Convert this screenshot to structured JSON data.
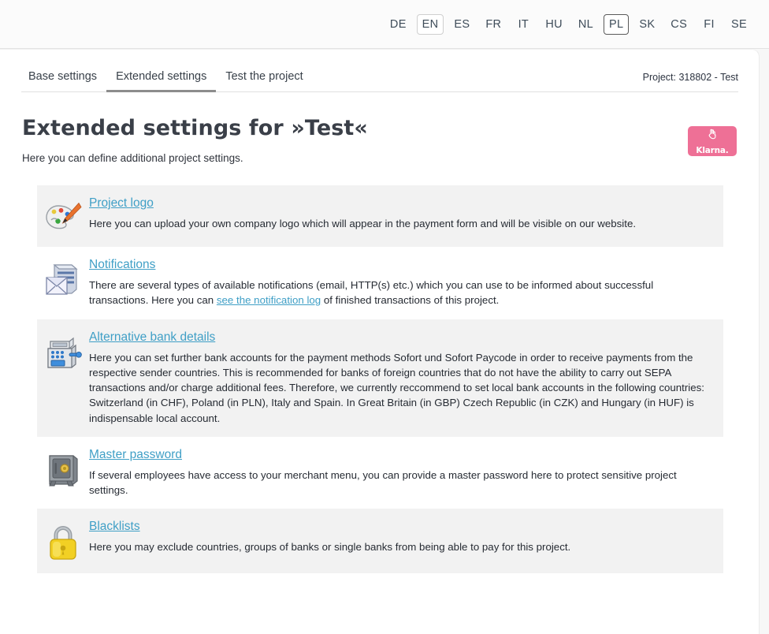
{
  "topbar": {
    "languages": [
      {
        "code": "DE",
        "state": "normal"
      },
      {
        "code": "EN",
        "state": "selected-light"
      },
      {
        "code": "ES",
        "state": "normal"
      },
      {
        "code": "FR",
        "state": "normal"
      },
      {
        "code": "IT",
        "state": "normal"
      },
      {
        "code": "HU",
        "state": "normal"
      },
      {
        "code": "NL",
        "state": "normal"
      },
      {
        "code": "PL",
        "state": "selected-dark"
      },
      {
        "code": "SK",
        "state": "normal"
      },
      {
        "code": "CS",
        "state": "normal"
      },
      {
        "code": "FI",
        "state": "normal"
      },
      {
        "code": "SE",
        "state": "normal"
      }
    ]
  },
  "tabs": [
    {
      "label": "Base settings",
      "active": false
    },
    {
      "label": "Extended settings",
      "active": true
    },
    {
      "label": "Test the project",
      "active": false
    }
  ],
  "project_label": "Project: 318802 - Test",
  "page": {
    "title": "Extended settings for »Test«",
    "subtitle": "Here you can define additional project settings."
  },
  "brand": {
    "name": "Klarna.",
    "icon": "peace-hand-icon",
    "color": "#ee7096"
  },
  "colors": {
    "link": "#3f9fc6",
    "shaded_row": "#f2f2f2",
    "tab_active_underline": "#8d8d8d",
    "topbar_bg": "#fbfbfb"
  },
  "sections": [
    {
      "id": "project-logo",
      "icon": "palette-icon",
      "title": "Project logo",
      "shaded": true,
      "desc_before": "Here you can upload your own company logo which will appear in the payment form and will be visible on our website.",
      "link_text": "",
      "desc_after": ""
    },
    {
      "id": "notifications",
      "icon": "server-envelope-icon",
      "title": "Notifications",
      "shaded": false,
      "desc_before": "There are several types of available notifications (email, HTTP(s) etc.) which you can use to be informed about successful transactions. Here you can ",
      "link_text": "see the notification log",
      "desc_after": " of finished transactions of this project."
    },
    {
      "id": "alternative-bank-details",
      "icon": "cash-register-icon",
      "title": "Alternative bank details",
      "shaded": true,
      "desc_before": "Here you can set further bank accounts for the payment methods Sofort und Sofort Paycode in order to receive payments from the respective sender countries. This is recommended for banks of foreign countries that do not have the ability to carry out SEPA transactions and/or charge additional fees. Therefore, we currently reccommend to set local bank accounts in the following countries: Switzerland (in CHF), Poland (in PLN), Italy and Spain. In Great Britain (in GBP) Czech Republic (in CZK) and Hungary (in HUF) is indispensable local account.",
      "link_text": "",
      "desc_after": ""
    },
    {
      "id": "master-password",
      "icon": "safe-icon",
      "title": "Master password",
      "shaded": false,
      "desc_before": "If several employees have access to your merchant menu, you can provide a master password here to protect sensitive project settings.",
      "link_text": "",
      "desc_after": ""
    },
    {
      "id": "blacklists",
      "icon": "padlock-icon",
      "title": "Blacklists",
      "shaded": true,
      "desc_before": "Here you may exclude countries, groups of banks or single banks from being able to pay for this project.",
      "link_text": "",
      "desc_after": ""
    }
  ]
}
